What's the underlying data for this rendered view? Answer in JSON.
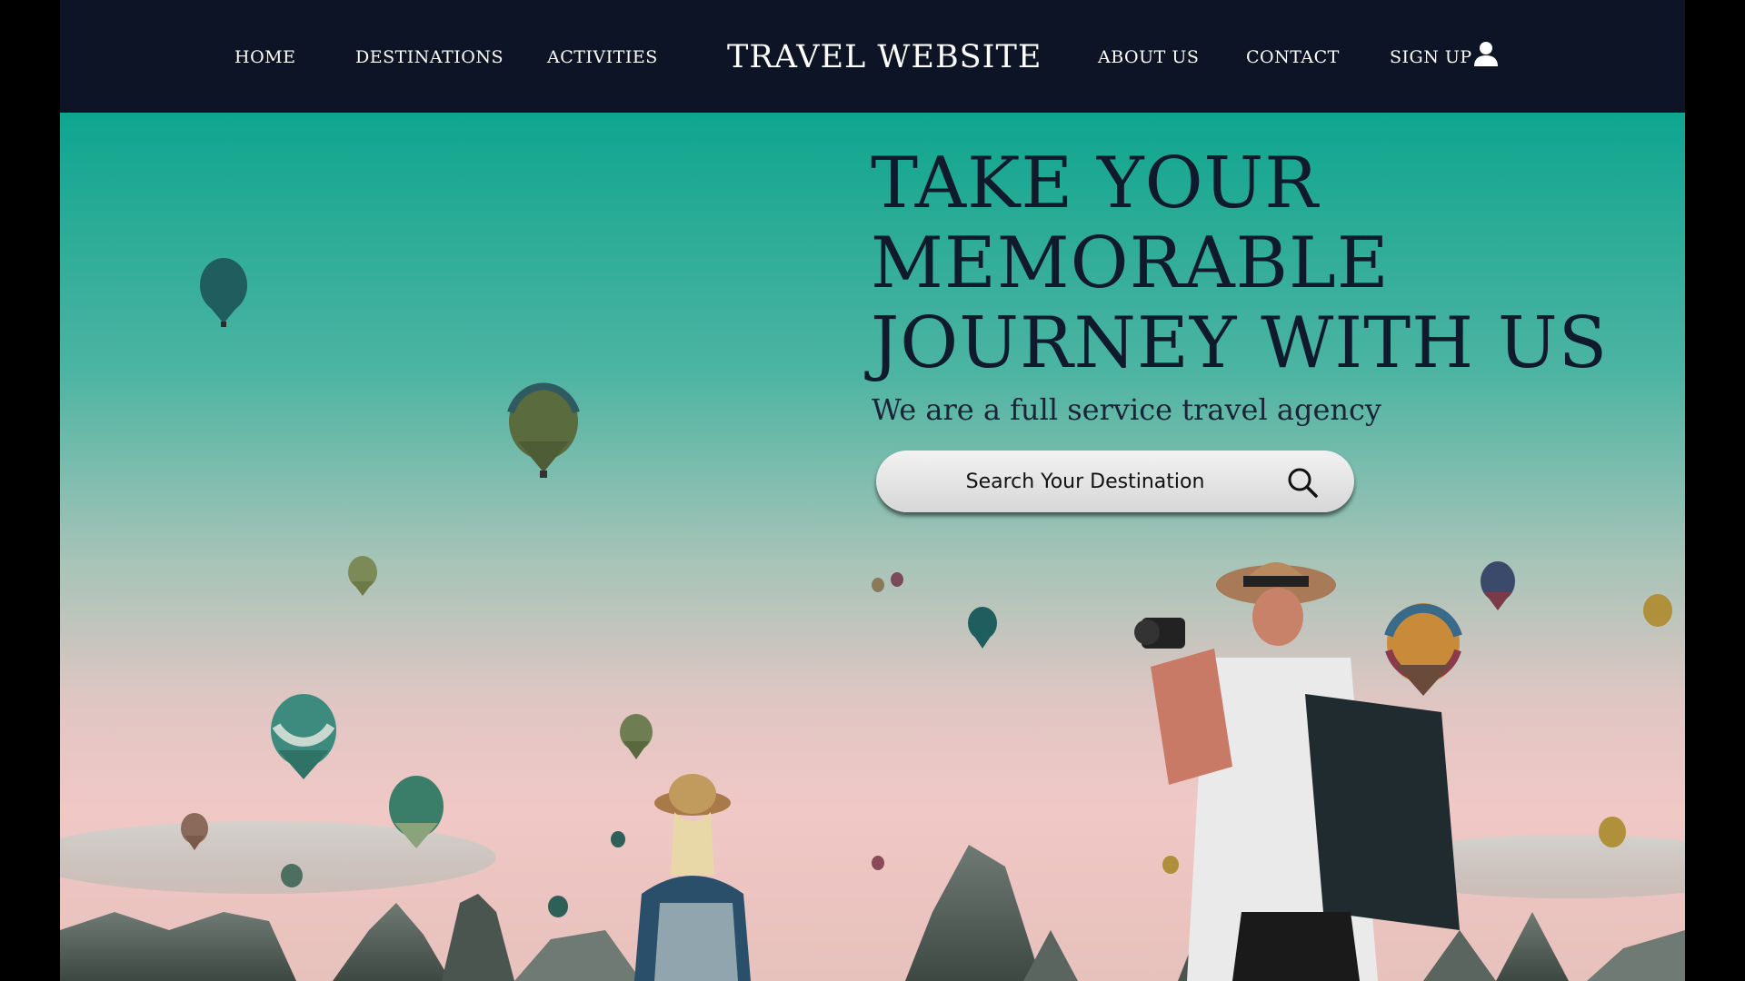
{
  "nav": {
    "left_links": [
      "HOME",
      "DESTINATIONS",
      "ACTIVITIES"
    ],
    "brand": "TRAVEL WEBSITE",
    "right_links": [
      "ABOUT US",
      "CONTACT"
    ],
    "sign_up": "SIGN UP",
    "user_icon": "user-icon"
  },
  "hero": {
    "headline_lines": [
      "TAKE YOUR",
      "MEMORABLE",
      "JOURNEY WITH US"
    ],
    "tagline": "We are a full service travel agency",
    "search": {
      "placeholder": "Search Your Destination",
      "icon": "search-icon"
    },
    "background_image": "hot-air-balloons-over-rock-formations-with-two-travelers"
  },
  "colors": {
    "nav_bg": "#0c1425",
    "nav_text": "#ffffff",
    "headline": "#0f1a2c",
    "sky_top": "#0fa58f",
    "sky_bottom": "#f0c8c6",
    "search_bg": "#e4e4e4"
  }
}
